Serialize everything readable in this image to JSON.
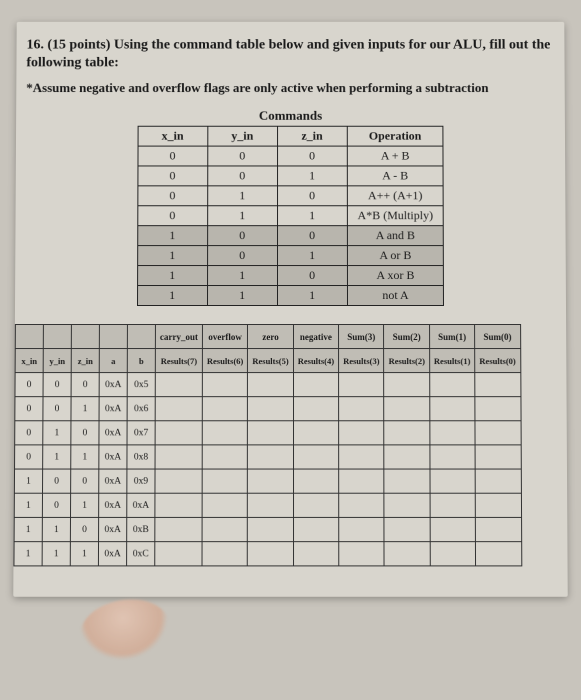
{
  "question": {
    "number": "16.",
    "points": "(15 points)",
    "text": "Using the command table below and given inputs for our ALU, fill out the following table:",
    "note": "*Assume negative and overflow flags are only active when performing a subtraction"
  },
  "commands": {
    "title": "Commands",
    "headers": [
      "x_in",
      "y_in",
      "z_in",
      "Operation"
    ],
    "rows": [
      {
        "x": "0",
        "y": "0",
        "z": "0",
        "op": "A + B",
        "shaded": false
      },
      {
        "x": "0",
        "y": "0",
        "z": "1",
        "op": "A - B",
        "shaded": false
      },
      {
        "x": "0",
        "y": "1",
        "z": "0",
        "op": "A++ (A+1)",
        "shaded": false
      },
      {
        "x": "0",
        "y": "1",
        "z": "1",
        "op": "A*B (Multiply)",
        "shaded": false
      },
      {
        "x": "1",
        "y": "0",
        "z": "0",
        "op": "A and B",
        "shaded": true
      },
      {
        "x": "1",
        "y": "0",
        "z": "1",
        "op": "A or B",
        "shaded": true
      },
      {
        "x": "1",
        "y": "1",
        "z": "0",
        "op": "A xor B",
        "shaded": true
      },
      {
        "x": "1",
        "y": "1",
        "z": "1",
        "op": "not A",
        "shaded": true
      }
    ]
  },
  "answer_table": {
    "top_headers": [
      "",
      "",
      "",
      "",
      "",
      "carry_out",
      "overflow",
      "zero",
      "negative",
      "Sum(3)",
      "Sum(2)",
      "Sum(1)",
      "Sum(0)"
    ],
    "sub_headers": [
      "x_in",
      "y_in",
      "z_in",
      "a",
      "b",
      "Results(7)",
      "Results(6)",
      "Results(5)",
      "Results(4)",
      "Results(3)",
      "Results(2)",
      "Results(1)",
      "Results(0)"
    ],
    "rows": [
      {
        "x": "0",
        "y": "0",
        "z": "0",
        "a": "0xA",
        "b": "0x5"
      },
      {
        "x": "0",
        "y": "0",
        "z": "1",
        "a": "0xA",
        "b": "0x6"
      },
      {
        "x": "0",
        "y": "1",
        "z": "0",
        "a": "0xA",
        "b": "0x7"
      },
      {
        "x": "0",
        "y": "1",
        "z": "1",
        "a": "0xA",
        "b": "0x8"
      },
      {
        "x": "1",
        "y": "0",
        "z": "0",
        "a": "0xA",
        "b": "0x9"
      },
      {
        "x": "1",
        "y": "0",
        "z": "1",
        "a": "0xA",
        "b": "0xA"
      },
      {
        "x": "1",
        "y": "1",
        "z": "0",
        "a": "0xA",
        "b": "0xB"
      },
      {
        "x": "1",
        "y": "1",
        "z": "1",
        "a": "0xA",
        "b": "0xC"
      }
    ]
  }
}
